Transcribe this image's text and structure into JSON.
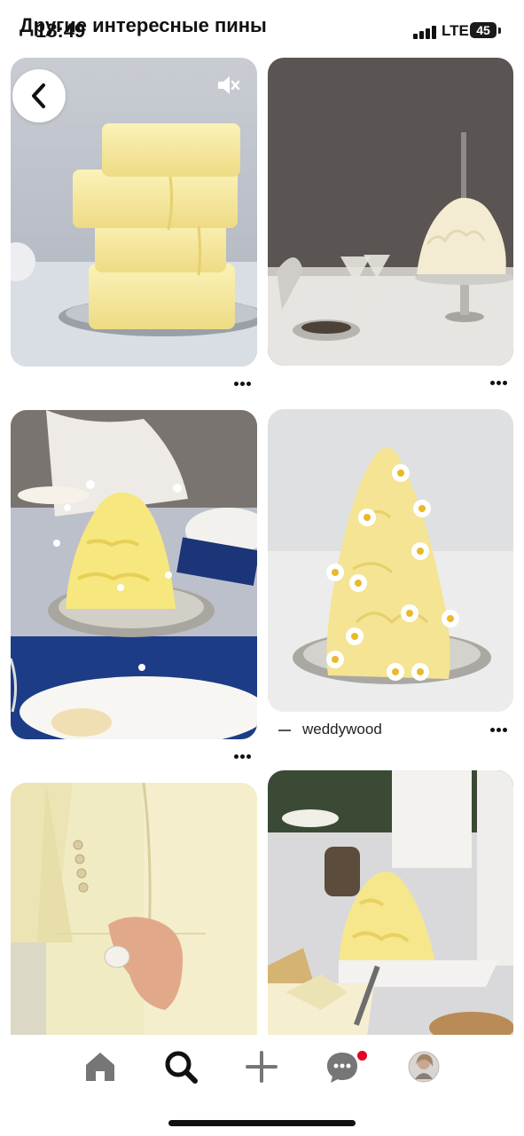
{
  "status": {
    "time": "18:49",
    "network": "LTE",
    "battery": "45"
  },
  "header": {
    "title": "Другие интересные пины"
  },
  "pins": [
    {
      "name": "butter-stack-pin"
    },
    {
      "name": "whipped-cream-cake-pin"
    },
    {
      "name": "butter-daisies-table-pin"
    },
    {
      "name": "butter-cone-daisies-pin",
      "source": "weddywood"
    },
    {
      "name": "yellow-suit-pin"
    },
    {
      "name": "butter-buffet-pin"
    }
  ],
  "icons": {
    "back": "back-arrow-icon",
    "mute": "muted-speaker-icon",
    "more": "more-dots-icon",
    "home": "home-icon",
    "search": "search-icon",
    "create": "plus-icon",
    "messages": "chat-bubble-icon",
    "profile": "avatar"
  },
  "colors": {
    "accent": "#e60023",
    "butter": "#f3e59b",
    "icon": "#767676"
  }
}
